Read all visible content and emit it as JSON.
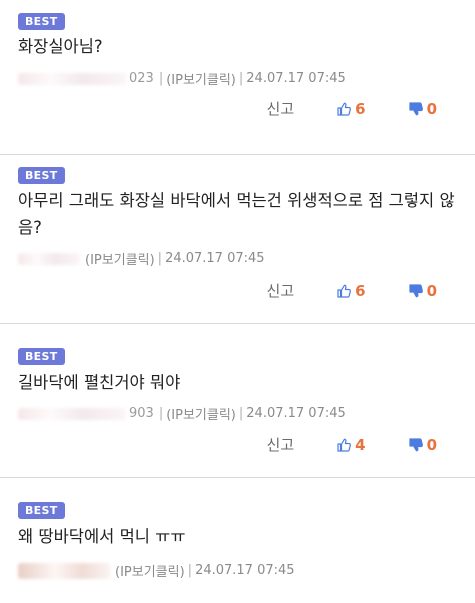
{
  "colors": {
    "badge": "#6d79d8",
    "like_icon": "#4d7ce0",
    "dislike_icon": "#4d7ce0",
    "count": "#e8733d"
  },
  "labels": {
    "best": "BEST",
    "report": "신고",
    "ip_click": "(IP보기클릭)",
    "separator": "|"
  },
  "comments": [
    {
      "text": "화장실아님?",
      "author_tail": "023",
      "date": "24.07.17 07:45",
      "likes": "6",
      "dislikes": "0"
    },
    {
      "text": "아무리 그래도 화장실 바닥에서 먹는건 위생적으로 점 그렇지 않음?",
      "author_tail": "",
      "date": "24.07.17 07:45",
      "likes": "6",
      "dislikes": "0"
    },
    {
      "text": "길바닥에 펼친거야 뭐야",
      "author_tail": "903",
      "date": "24.07.17 07:45",
      "likes": "4",
      "dislikes": "0"
    },
    {
      "text": "왜 땅바닥에서 먹니 ㅠㅠ",
      "author_tail": "",
      "date": "24.07.17 07:45"
    }
  ]
}
